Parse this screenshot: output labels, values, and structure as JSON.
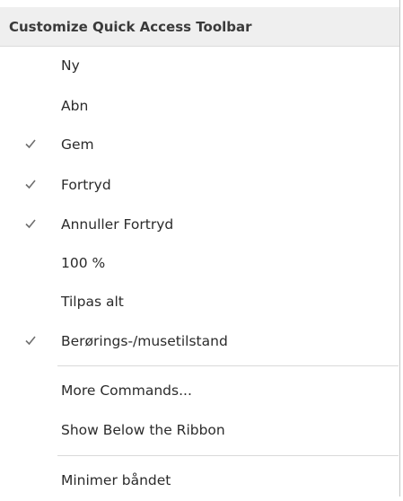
{
  "menu": {
    "title": "Customize Quick Access Toolbar",
    "items": [
      {
        "label": "Ny",
        "checked": false
      },
      {
        "label": "Abn",
        "checked": false
      },
      {
        "label": "Gem",
        "checked": true
      },
      {
        "label": "Fortryd",
        "checked": true
      },
      {
        "label": "Annuller Fortryd",
        "checked": true
      },
      {
        "label": "100 %",
        "checked": false
      },
      {
        "label": "Tilpas alt",
        "checked": false
      },
      {
        "label": "Berørings-/musetilstand",
        "checked": true
      },
      {
        "label": "More Commands...",
        "checked": false
      },
      {
        "label": "Show Below the Ribbon",
        "checked": false
      },
      {
        "label": "Minimer båndet",
        "checked": false
      }
    ],
    "check_icon": "checkmark-icon",
    "colors": {
      "header_bg": "#efefef",
      "check": "#6f6f6f",
      "text": "#2b2b2b"
    }
  }
}
